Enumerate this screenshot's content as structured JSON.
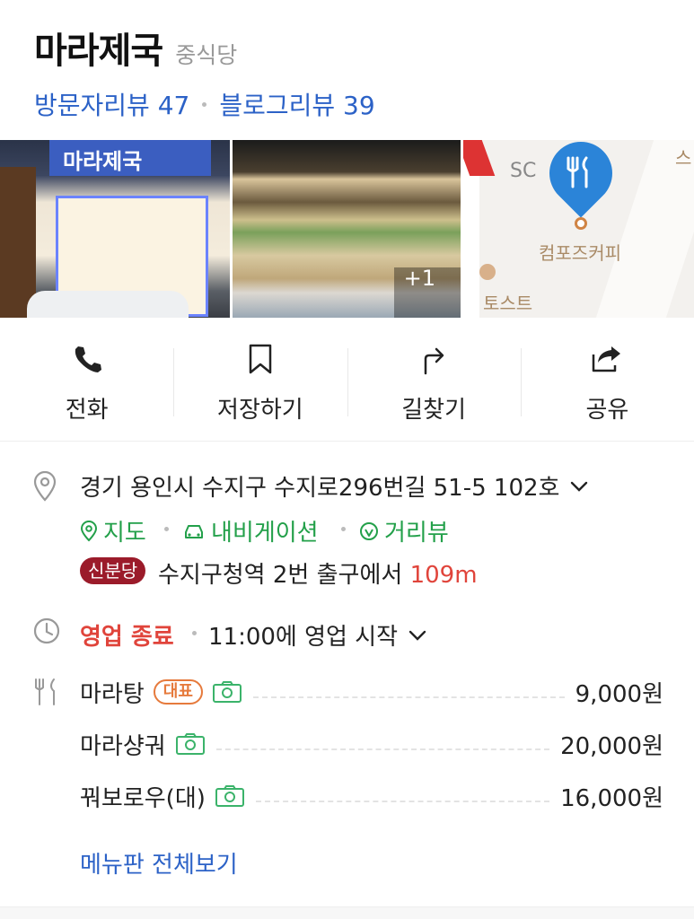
{
  "store": {
    "name": "마라제국",
    "category": "중식당"
  },
  "reviews": {
    "visitor": "방문자리뷰 47",
    "blog": "블로그리뷰 39"
  },
  "photos": {
    "sign_text": "마라제국",
    "more_count": "+1",
    "map_labels": {
      "sc": "SC",
      "cafe": "컴포즈커피",
      "toast": "토스트",
      "corner": "스"
    }
  },
  "actions": [
    {
      "label": "전화",
      "icon": "phone-icon"
    },
    {
      "label": "저장하기",
      "icon": "bookmark-icon"
    },
    {
      "label": "길찾기",
      "icon": "directions-icon"
    },
    {
      "label": "공유",
      "icon": "share-icon"
    }
  ],
  "address": {
    "text": "경기 용인시 수지구 수지로296번길 51-5 102호",
    "links": {
      "map": "지도",
      "navigation": "내비게이션",
      "streetview": "거리뷰"
    },
    "subway": {
      "line": "신분당",
      "station": "수지구청역",
      "exit": "2번 출구에서",
      "distance": "109m",
      "line_color": "#9b1b2a"
    }
  },
  "hours": {
    "status": "영업 종료",
    "next_open": "11:00에 영업 시작"
  },
  "menu": {
    "items": [
      {
        "name": "마라탕",
        "badge": "대표",
        "price": "9,000원"
      },
      {
        "name": "마라샹궈",
        "badge": "",
        "price": "20,000원"
      },
      {
        "name": "꿔보로우(대)",
        "badge": "",
        "price": "16,000원"
      }
    ],
    "view_all": "메뉴판 전체보기"
  },
  "colors": {
    "link_blue": "#2c62c7",
    "green": "#23a04a",
    "red": "#e0443b",
    "badge_orange": "#e67a3c",
    "pin_blue": "#2b84d8"
  }
}
